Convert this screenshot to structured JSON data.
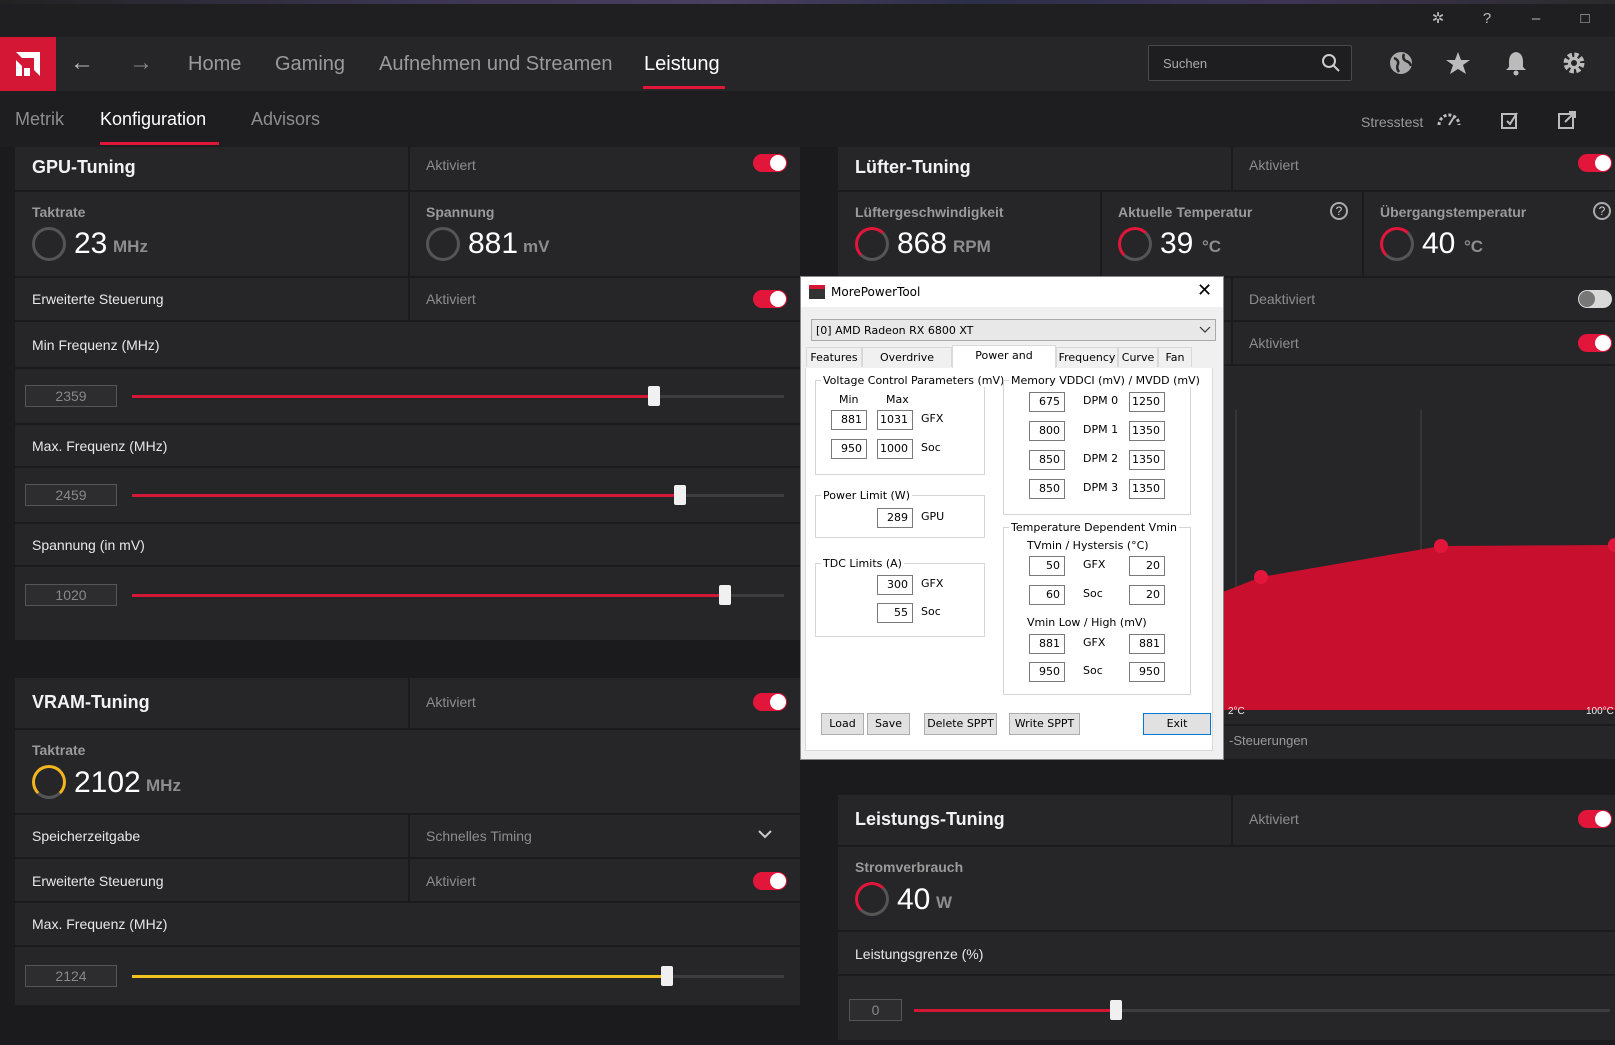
{
  "title_bar": {
    "icons": [
      "bug-icon",
      "help-icon",
      "minimize-icon",
      "maximize-icon"
    ]
  },
  "nav": {
    "items": [
      "Home",
      "Gaming",
      "Aufnehmen und Streamen",
      "Leistung"
    ],
    "active": "Leistung",
    "search_placeholder": "Suchen",
    "accent": "#e2163b"
  },
  "subnav": {
    "items": [
      "Metrik",
      "Konfiguration",
      "Advisors"
    ],
    "active": "Konfiguration",
    "stresstest": "Stresstest"
  },
  "gpu": {
    "title": "GPU-Tuning",
    "status": "Aktiviert",
    "clock_label": "Taktrate",
    "clock_value": "23",
    "clock_unit": "MHz",
    "voltage_label": "Spannung",
    "voltage_value": "881",
    "voltage_unit": "mV",
    "adv_label": "Erweiterte Steuerung",
    "adv_status": "Aktiviert",
    "min_label": "Min Frequenz (MHz)",
    "min_value": "2359",
    "min_frac": 0.8,
    "max_label": "Max. Frequenz (MHz)",
    "max_value": "2459",
    "max_frac": 0.84,
    "volt_label": "Spannung (in mV)",
    "volt_value": "1020",
    "volt_frac": 0.91
  },
  "vram": {
    "title": "VRAM-Tuning",
    "status": "Aktiviert",
    "clock_label": "Taktrate",
    "clock_value": "2102",
    "clock_unit": "MHz",
    "timing_label": "Speicherzeitgabe",
    "timing_value": "Schnelles Timing",
    "adv_label": "Erweiterte Steuerung",
    "adv_status": "Aktiviert",
    "max_label": "Max. Frequenz (MHz)",
    "max_value": "2124",
    "max_frac": 0.82
  },
  "fan": {
    "title": "Lüfter-Tuning",
    "status": "Aktiviert",
    "speed_label": "Lüftergeschwindigkeit",
    "speed_value": "868",
    "speed_unit": "RPM",
    "temp_label": "Aktuelle Temperatur",
    "temp_value": "39",
    "temp_unit": "°C",
    "junction_label": "Übergangstemperatur",
    "junction_value": "40",
    "junction_unit": "°C",
    "row1_status": "Deaktiviert",
    "row2_status": "Aktiviert",
    "axis_min": "2°C",
    "axis_max": "100°C",
    "controls_label": "-Steuerungen"
  },
  "power": {
    "title": "Leistungs-Tuning",
    "status": "Aktiviert",
    "usage_label": "Stromverbrauch",
    "usage_value": "40",
    "usage_unit": "W",
    "limit_label": "Leistungsgrenze (%)",
    "limit_value": "0",
    "limit_frac": 0.29
  },
  "mpt": {
    "title": "MorePowerTool",
    "device": "[0] AMD Radeon RX 6800 XT",
    "tabs": [
      "Features",
      "Overdrive Limits",
      "Power and Voltage",
      "Frequency",
      "Curve",
      "Fan"
    ],
    "active_tab": "Power and Voltage",
    "vcp_title": "Voltage Control Parameters (mV)",
    "min_hdr": "Min",
    "max_hdr": "Max",
    "gfx_min": "881",
    "gfx_max": "1031",
    "soc_min": "950",
    "soc_max": "1000",
    "gfx": "GFX",
    "soc": "Soc",
    "gpu": "GPU",
    "pl_title": "Power Limit (W)",
    "pl_value": "289",
    "tdc_title": "TDC Limits (A)",
    "tdc_gfx": "300",
    "tdc_soc": "55",
    "mem_title": "Memory VDDCI (mV) / MVDD (mV)",
    "dpm": [
      {
        "l": "675",
        "n": "DPM 0",
        "r": "1250"
      },
      {
        "l": "800",
        "n": "DPM 1",
        "r": "1350"
      },
      {
        "l": "850",
        "n": "DPM 2",
        "r": "1350"
      },
      {
        "l": "850",
        "n": "DPM 3",
        "r": "1350"
      }
    ],
    "tdv_title": "Temperature Dependent Vmin",
    "tvmin_title": "TVmin / Hystersis (°C)",
    "tv_gfx_l": "50",
    "tv_gfx_r": "20",
    "tv_soc_l": "60",
    "tv_soc_r": "20",
    "vmin_title": "Vmin Low / High (mV)",
    "vm_gfx_l": "881",
    "vm_gfx_r": "881",
    "vm_soc_l": "950",
    "vm_soc_r": "950",
    "buttons": [
      "Load",
      "Save",
      "Delete SPPT",
      "Write SPPT",
      "Exit"
    ]
  }
}
